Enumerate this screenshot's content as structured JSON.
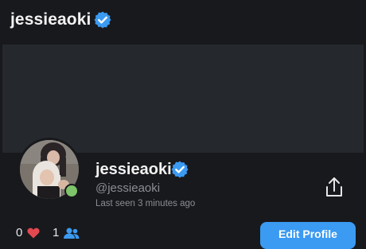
{
  "header": {
    "title": "jessieaoki"
  },
  "profile": {
    "name": "jessieaoki",
    "handle": "@jessieaoki",
    "last_seen": "Last seen 3 minutes ago",
    "status": "online"
  },
  "stats": {
    "likes": "0",
    "subscribers": "1"
  },
  "actions": {
    "edit_profile_label": "Edit Profile"
  },
  "colors": {
    "background": "#18191d",
    "cover": "#25282d",
    "accent": "#3b9af2",
    "online": "#7ec46a",
    "muted_text": "#8a8d93"
  },
  "icons": {
    "verified": "verified-badge-icon",
    "share": "share-icon",
    "likes": "heart-icon",
    "subscribers": "users-icon"
  }
}
